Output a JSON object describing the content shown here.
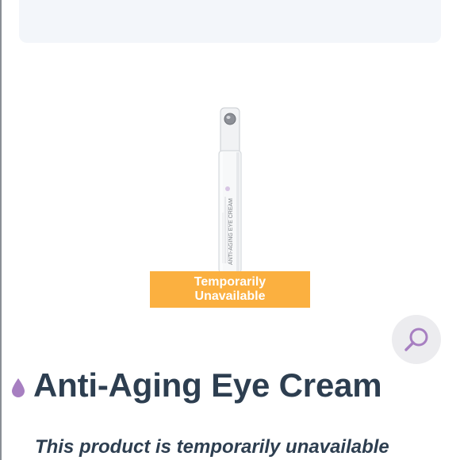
{
  "product": {
    "title": "Anti-Aging Eye Cream",
    "status_message": "This product is temporarily unavailable",
    "image_label": "ANTI-AGING EYE CREAM"
  },
  "overlay": {
    "line1": "Temporarily",
    "line2": "Unavailable"
  },
  "icons": {
    "zoom": "magnifier-icon",
    "title_bullet": "drop-icon"
  },
  "colors": {
    "accent": "#a77fc1",
    "overlay": "#fbb040",
    "title": "#2d3e50"
  }
}
